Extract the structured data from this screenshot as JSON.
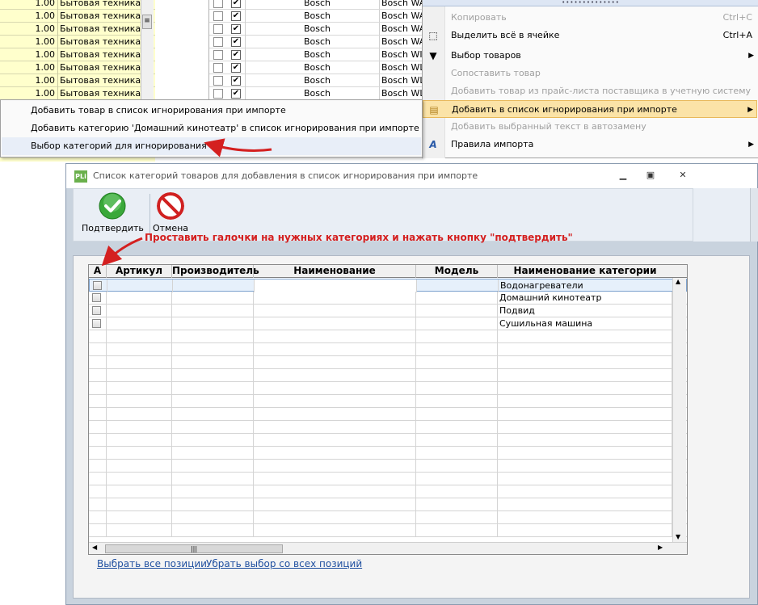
{
  "background_grid": {
    "rows": [
      {
        "num": "1.00",
        "category": "Бытовая техника /"
      },
      {
        "num": "1.00",
        "category": "Бытовая техника /"
      },
      {
        "num": "1.00",
        "category": "Бытовая техника /"
      },
      {
        "num": "1.00",
        "category": "Бытовая техника /"
      },
      {
        "num": "1.00",
        "category": "Бытовая техника /"
      },
      {
        "num": "1.00",
        "category": "Бытовая техника /"
      },
      {
        "num": "1.00",
        "category": "Бытовая техника /"
      },
      {
        "num": "1.00",
        "category": "Бытовая техника /"
      }
    ],
    "mid_rows": [
      {
        "brand": "Bosch",
        "model": "Bosch WAB"
      },
      {
        "brand": "Bosch",
        "model": "Bosch WAE"
      },
      {
        "brand": "Bosch",
        "model": "Bosch WAS"
      },
      {
        "brand": "Bosch",
        "model": "Bosch WAS"
      },
      {
        "brand": "Bosch",
        "model": "Bosch WIS"
      },
      {
        "brand": "Bosch",
        "model": "Bosch WLX"
      },
      {
        "brand": "Bosch",
        "model": "Bosch WLX"
      },
      {
        "brand": "Bosch",
        "model": "Bosch WLX"
      }
    ]
  },
  "submenu": {
    "items": [
      "Добавить товар в список игнорирования при импорте",
      "Добавить категорию 'Домашний кинотеатр' в список игнорирования при импорте",
      "Выбор категорий для игнорирования"
    ]
  },
  "context_menu": {
    "copy": "Копировать",
    "copy_shortcut": "Ctrl+C",
    "select_all": "Выделить всё в ячейке",
    "select_all_shortcut": "Ctrl+A",
    "select_products": "Выбор товаров",
    "match_product": "Сопоставить товар",
    "add_from_pricelist": "Добавить товар из прайс-листа поставщика в учетную систему",
    "add_to_ignore": "Добавить в список игнорирования при импорте",
    "add_to_autoreplace": "Добавить выбранный текст в автозамену",
    "import_rules": "Правила импорта"
  },
  "dialog": {
    "title": "Список категорий товаров для добавления в список игнорирования при импорте",
    "app_icon": "PLi",
    "toolbar": {
      "confirm": "Подтвердить",
      "cancel": "Отмена"
    },
    "annotation": "Проставить галочки на нужных категориях и нажать кнопку \"подтвердить\"",
    "grid": {
      "columns": [
        "А",
        "Артикул",
        "Производитель",
        "Наименование",
        "Модель",
        "Наименование категории"
      ],
      "rows": [
        {
          "category": "Водонагреватели"
        },
        {
          "category": "Домашний кинотеатр"
        },
        {
          "category": "Подвид"
        },
        {
          "category": "Сушильная машина"
        }
      ]
    },
    "select_all": "Выбрать все позиции",
    "deselect_all": "Убрать выбор со всех позиций"
  },
  "colors": {
    "annotation_red": "#d42020",
    "confirm_green": "#3aa83a",
    "cancel_red": "#d02020",
    "menu_highlight": "#fbe3a7",
    "link_blue": "#2050a0"
  }
}
